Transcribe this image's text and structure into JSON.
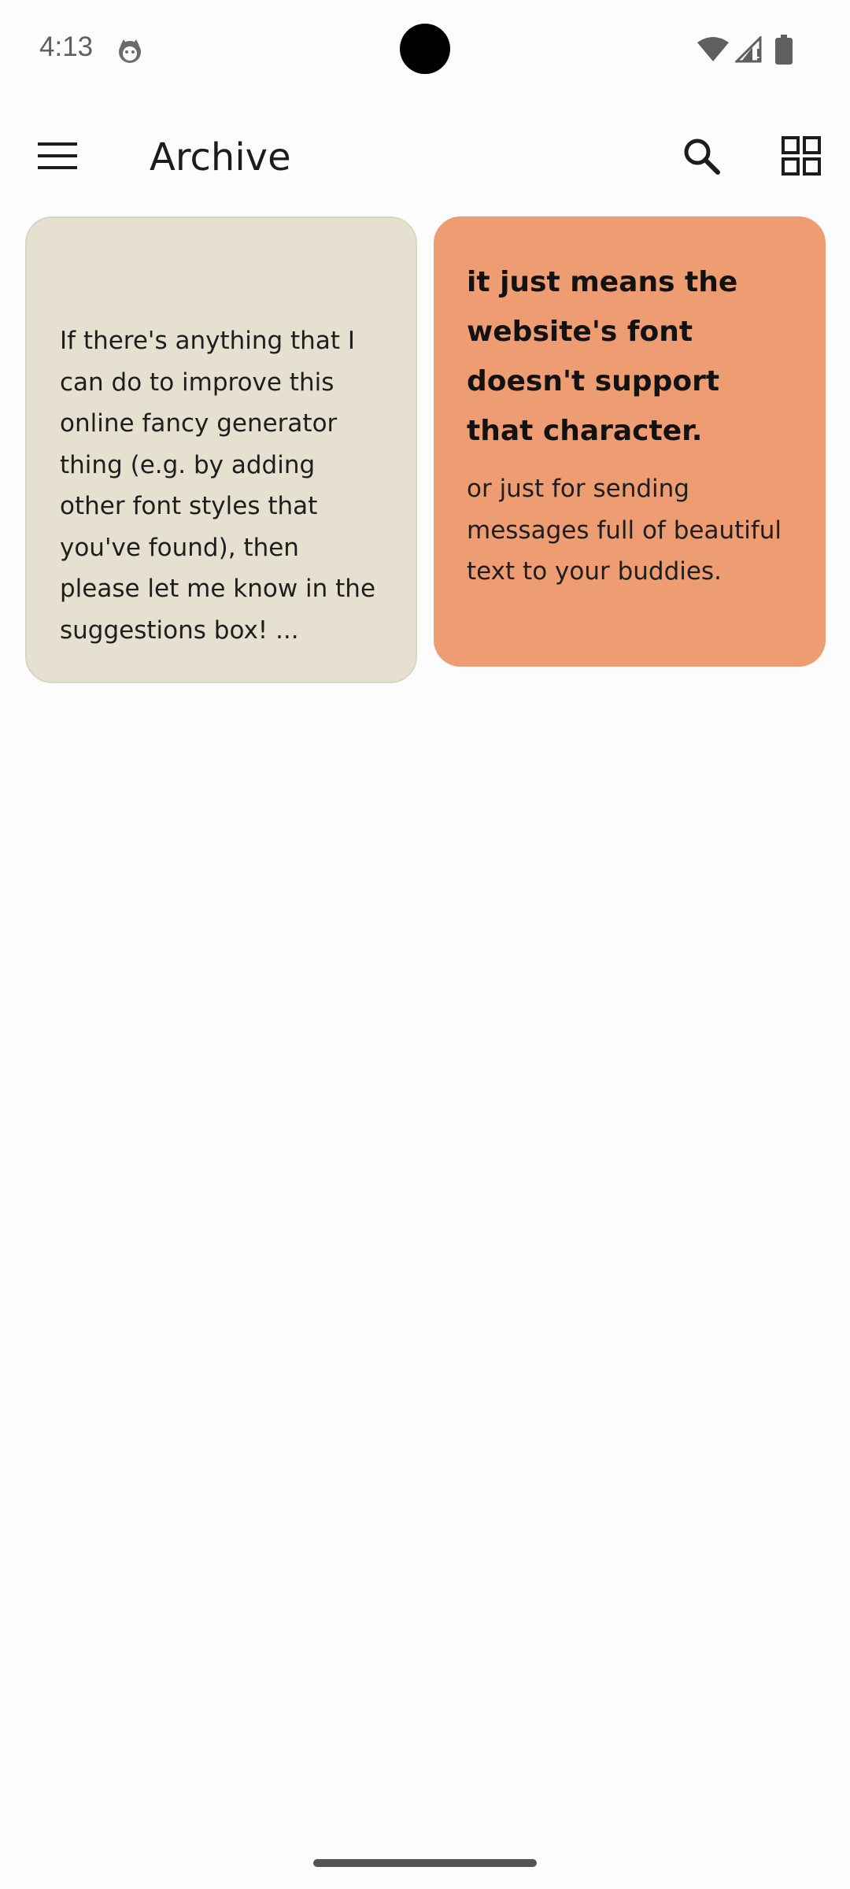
{
  "status_bar": {
    "time": "4:13",
    "notification_icon": "android-cat-icon",
    "wifi_icon": "wifi-icon",
    "signal_icon": "signal-icon",
    "battery_icon": "battery-icon"
  },
  "app_bar": {
    "title": "Archive",
    "menu_icon": "hamburger-menu-icon",
    "search_icon": "search-icon",
    "layout_icon": "grid-view-icon"
  },
  "notes": [
    {
      "title": "",
      "body": "If there's anything that I can do to improve this online fancy generator thing (e.g. by adding other font styles that you've found), then please let me know in the suggestions box! ...",
      "color": "#e5e0cf"
    },
    {
      "title": "it just means the website's font doesn't support that character.",
      "body": "or just for sending messages full of beautiful text to your buddies.",
      "color": "#ee9d73"
    }
  ],
  "colors": {
    "background": "#fcfcfc",
    "text": "#1c1c1c"
  }
}
